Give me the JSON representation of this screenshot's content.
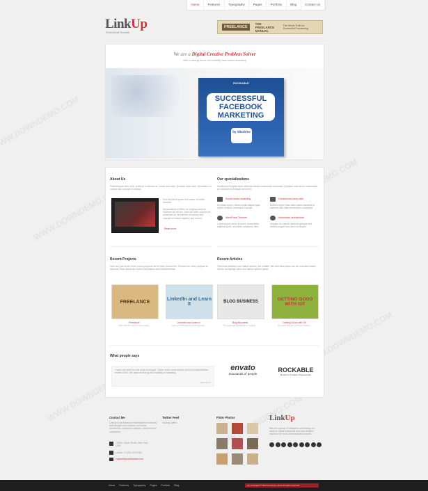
{
  "nav": {
    "items": [
      "Home",
      "Features",
      "Typography",
      "Pages",
      "Portfolio",
      "Blog",
      "Contact Us"
    ]
  },
  "logo": {
    "part1": "Link",
    "part2": "Up",
    "tagline": "Professional Template"
  },
  "header_ad": {
    "badge": "FREELANCE",
    "title": "THE FREELANCE MANUAL",
    "text": "The Whole Truth on Successful Freelancing"
  },
  "hero": {
    "tagline_prefix": "We are a ",
    "tagline_highlight": "Digital Creative Problem Solver",
    "subtagline": "with a strong focus on usability and online branding",
    "cover_brand": "ROCKABLE",
    "cover_title_1": "SUCCESSFUL",
    "cover_title_2": "FACEBOOK",
    "cover_title_3": "MARKETING",
    "cover_by": "by Sitedrive",
    "prev": "‹",
    "next": "›"
  },
  "about": {
    "title": "About Us",
    "intro": "Pellentesque nibh nunc, pulvinar in ultrices at, ornare sed ante. Quisque dolor nibh, fermentum id cursus sed, suscipit ut massa.",
    "text1": "Duis tincidunt ipsum sed quam convallis rhoncus.",
    "text2": "Suspendisse et libero eu magna placerat tincidunt vel vel leo. Nam leo nibh, suscipit ac venenatis sit, fermentum et cursus sed suscipit et massa dapibus sed ornare.",
    "read_more": "Read more"
  },
  "specializations": {
    "title": "Our specializations",
    "intro": "Vestibulum fringilla lacus vehicula massa malesuada venenatis. Quisque urna lacus, malesuada ac vehicula id, tristique sed enim.",
    "items": [
      {
        "title": "Social media marketing",
        "text": "Ut ipsum enim, rutrum mollis aliquet quis, luctus ut tellus consequat suscipit."
      },
      {
        "title": "Commercial photo sets",
        "text": "Nulla in turpis vitae dolor luctus tincidunt in eleifend nibh vitae fermentum consequat."
      },
      {
        "title": "WordPress Themes",
        "text": "Lorem ipsum dolor sit amet, consectetur adipiscing elit, sed diam nonummy nibh."
      },
      {
        "title": "Information architecture",
        "text": "Aliquam eu blandit placerat quisque sed lobortis augue duis dolor in feugiat."
      }
    ]
  },
  "recent_projects": {
    "title": "Recent Projects",
    "intro": "Here are just some of the recent projects we've been involved in. Explore our other projects to discover more about our recent innovations and achievements.",
    "items": [
      {
        "art": "FREELANCE",
        "title": "Freelance",
        "subtitle": "Why Should Trust on Successful..."
      },
      {
        "art": "LinkedIn and Learn It",
        "title": "LinkedIn and Learn It",
        "subtitle": "Learn to leverage the professionals..."
      }
    ]
  },
  "recent_articles": {
    "title": "Recent Articles",
    "intro": "This block displays your latest articles, the subtitle, title and description are all controlled easily via the homepage tab in the admin options panel.",
    "items": [
      {
        "art": "BLOG BUSINESS",
        "title": "Blog Business",
        "subtitle": "The essential handbook to creating..."
      },
      {
        "art": "GETTING GOOD WITH GIT",
        "title": "Getting Good with Git",
        "subtitle": "The tools will see you from Getting..."
      }
    ]
  },
  "testimonials": {
    "title": "What people says",
    "quote": "I have one word for this book: thorough. I have never come across such a comprehensive review of ALL the aspects that go into building a marketing.",
    "author": "Mike Roset"
  },
  "partners": [
    {
      "name": "envato",
      "tagline": "thousands of people"
    },
    {
      "name": "ROCKABLE",
      "tagline": "Books for Creative Professionals"
    }
  ],
  "footer": {
    "contact": {
      "title": "Contact Me",
      "text": "LinkUp is an American multinational company that designs and markets consumer electronics, computer software, and personal computers.",
      "address": "70345, Some Street, New York, USA",
      "phone": "phone: +1 (05) 125-9763",
      "email": "support@yourdomain.com"
    },
    "twitter": {
      "title": "Twitter Feed",
      "text": "loading twitter..."
    },
    "flickr": {
      "title": "Flickr Photos"
    },
    "about": {
      "logo_part1": "Link",
      "logo_part2": "Up",
      "text": "We are a group of designers combining our skills to create traditional and new creative solutions for your communication issues."
    }
  },
  "bottom": {
    "links": [
      "Home",
      "Features",
      "Typography",
      "Pages",
      "Portfolio",
      "Blog"
    ],
    "copyright": "(C) Copyright © 2013 Company name All rights reserved"
  },
  "watermark": "WWW.DOWNDEMO.COM",
  "colors": {
    "accent": "#c8343a",
    "dark": "#1e1e1e",
    "background": "#f0f0f0"
  }
}
